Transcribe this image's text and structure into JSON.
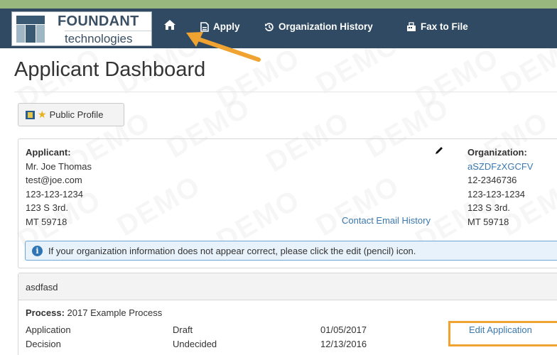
{
  "brand": {
    "name": "FOUNDANT",
    "subtitle": "technologies",
    "colors": {
      "navbar": "#2f4a62",
      "topStrip": "#97b77e",
      "link": "#3b78b0",
      "highlight": "#f0a330"
    }
  },
  "nav": {
    "home_icon": "home-icon",
    "items": [
      {
        "label": "Apply",
        "icon": "file-icon"
      },
      {
        "label": "Organization History",
        "icon": "history-icon"
      },
      {
        "label": "Fax to File",
        "icon": "fax-icon"
      }
    ]
  },
  "watermark": "DEMO",
  "page": {
    "title": "Applicant Dashboard"
  },
  "profile_button": {
    "label": "Public Profile"
  },
  "applicant": {
    "heading": "Applicant:",
    "name": "Mr. Joe Thomas",
    "email": "test@joe.com",
    "phone": "123-123-1234",
    "address": "123 S 3rd.",
    "city": "MT 59718"
  },
  "organization": {
    "heading": "Organization:",
    "name": "aSZDFzXGCFV",
    "ein": "12-2346736",
    "phone": "123-123-1234",
    "address": "123 S 3rd.",
    "city": "MT 59718"
  },
  "contact_email_history": "Contact Email History",
  "alert": {
    "text": "If your organization information does not appear correct, please click the edit (pencil) icon."
  },
  "process_panel": {
    "header": "asdfasd",
    "process_label": "Process:",
    "process_name": "2017 Example Process",
    "rows": [
      {
        "stage": "Application",
        "status": "Draft",
        "date": "01/05/2017",
        "action": "Edit Application"
      },
      {
        "stage": "Decision",
        "status": "Undecided",
        "date": "12/13/2016",
        "action": ""
      }
    ]
  }
}
